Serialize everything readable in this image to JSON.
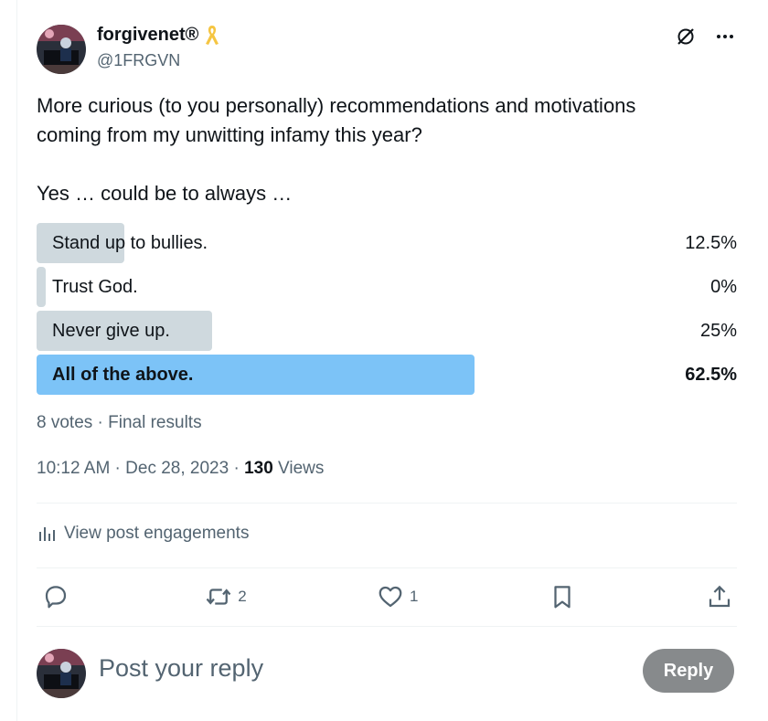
{
  "author": {
    "display_name": "forgivenet®",
    "handle": "@1FRGVN",
    "badge_icon": "awareness-ribbon-icon"
  },
  "post": {
    "line1": "More curious (to you personally) recommendations and motivations",
    "line2": "coming from my unwitting infamy this year?",
    "line3": "Yes … could be to always …"
  },
  "poll": {
    "options": [
      {
        "label": "Stand up to bullies.",
        "percent_text": "12.5%",
        "percent": 12.5,
        "winner": false
      },
      {
        "label": "Trust God.",
        "percent_text": "0%",
        "percent": 0,
        "winner": false
      },
      {
        "label": "Never give up.",
        "percent_text": "25%",
        "percent": 25,
        "winner": false
      },
      {
        "label": "All of the above.",
        "percent_text": "62.5%",
        "percent": 62.5,
        "winner": true
      }
    ],
    "summary": "8 votes · Final results"
  },
  "meta": {
    "time": "10:12 AM · Dec 28, 2023 · ",
    "views_count": "130",
    "views_label": " Views"
  },
  "engagements_label": "View post engagements",
  "actions": {
    "reply_count": "",
    "repost_count": "2",
    "like_count": "1"
  },
  "composer": {
    "placeholder": "Post your reply",
    "reply_label": "Reply"
  },
  "colors": {
    "accent_bar": "#7cc3f7",
    "bar": "#cfd9de",
    "muted_text": "#536471",
    "reply_button": "#878a8c",
    "ribbon": "#f5c542"
  }
}
